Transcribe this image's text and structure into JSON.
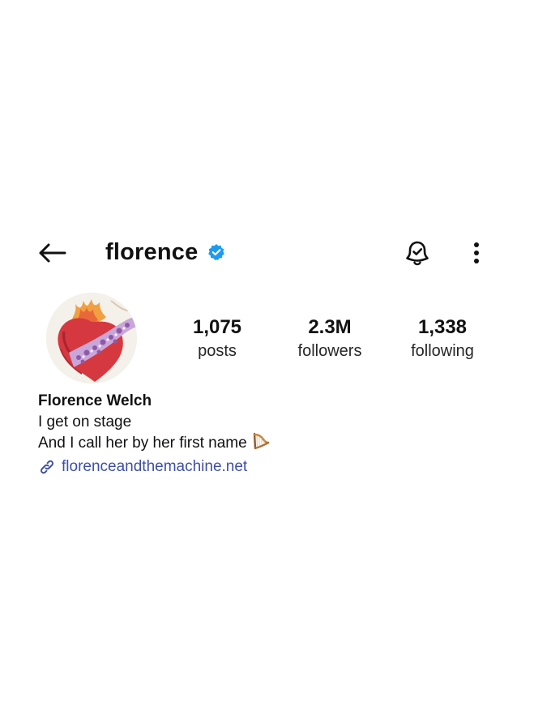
{
  "header": {
    "username": "florence",
    "back_icon": "arrow-left-icon",
    "verified_icon": "verified-badge-icon",
    "notification_icon": "bell-check-icon",
    "more_icon": "more-vertical-icon"
  },
  "profile": {
    "avatar_icon": "avatar-sacred-heart-painting",
    "stats": [
      {
        "value": "1,075",
        "label": "posts"
      },
      {
        "value": "2.3M",
        "label": "followers"
      },
      {
        "value": "1,338",
        "label": "following"
      }
    ],
    "display_name": "Florence Welch",
    "bio_lines": [
      "I get on stage",
      "And I call her by her first name"
    ],
    "bio_emoji": "harp-emoji",
    "link": {
      "text": "florenceandthemachine.net",
      "icon": "link-icon"
    }
  },
  "colors": {
    "verified": "#1d9bf0",
    "link": "#3d4fa8",
    "text": "#111111"
  }
}
